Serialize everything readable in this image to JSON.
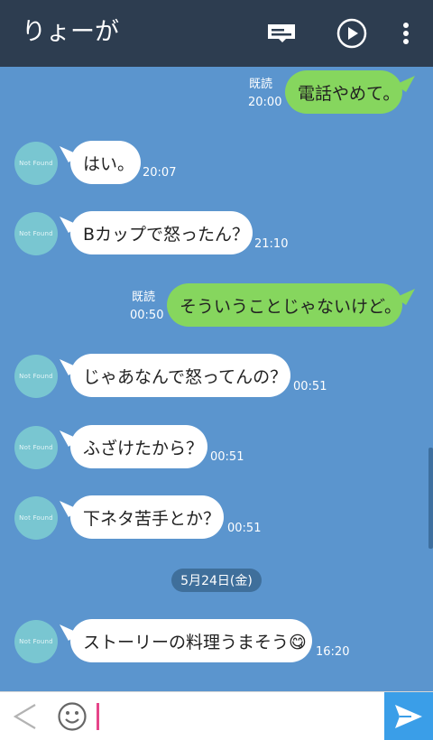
{
  "header": {
    "title": "りょーが",
    "icons": [
      "memo-icon",
      "play-icon",
      "more-vertical-icon"
    ]
  },
  "chat": {
    "avatar_text": "Not Found",
    "date_separator": "5月24日(金)",
    "messages": [
      {
        "direction": "out",
        "text": "電話やめて。",
        "time": "20:00",
        "read": "既読"
      },
      {
        "direction": "in",
        "text": "はい。",
        "time": "20:07"
      },
      {
        "direction": "in",
        "text": "Bカップで怒ったん？",
        "time": "21:10"
      },
      {
        "direction": "out",
        "text": "そういうことじゃないけど。",
        "time": "00:50",
        "read": "既読"
      },
      {
        "direction": "in",
        "text": "じゃあなんで怒ってんの？",
        "time": "00:51"
      },
      {
        "direction": "in",
        "text": "ふざけたから？",
        "time": "00:51"
      },
      {
        "direction": "in",
        "text": "下ネタ苦手とか？",
        "time": "00:51"
      },
      {
        "direction": "in",
        "text": "ストーリーの料理うまそう😋",
        "time": "16:20"
      }
    ]
  },
  "input": {
    "value": "",
    "icons": [
      "back-chevron-icon",
      "emoji-icon",
      "send-icon"
    ]
  },
  "colors": {
    "header_bg": "#2d3d50",
    "chat_bg": "#5b95ce",
    "incoming_bubble": "#ffffff",
    "outgoing_bubble": "#86d65e",
    "send_button": "#3a9ee8",
    "date_pill": "#3f6f9b"
  }
}
